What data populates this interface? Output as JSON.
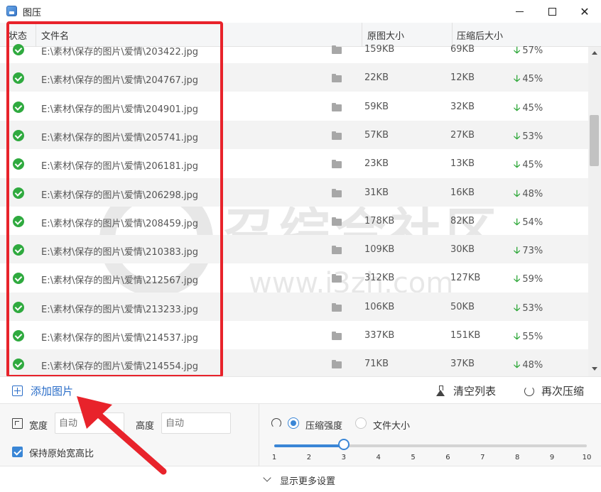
{
  "window": {
    "title": "图压",
    "minimize_icon": "minimize-icon",
    "maximize_icon": "maximize-icon",
    "close_icon": "close-icon"
  },
  "table": {
    "headers": {
      "status": "状态",
      "filename": "文件名",
      "original_size": "原图大小",
      "compressed_size": "压缩后大小"
    },
    "rows": [
      {
        "path": "E:\\素材\\保存的图片\\爱情\\203422.jpg",
        "original": "159KB",
        "compressed": "69KB",
        "ratio": "57%"
      },
      {
        "path": "E:\\素材\\保存的图片\\爱情\\204767.jpg",
        "original": "22KB",
        "compressed": "12KB",
        "ratio": "45%"
      },
      {
        "path": "E:\\素材\\保存的图片\\爱情\\204901.jpg",
        "original": "59KB",
        "compressed": "32KB",
        "ratio": "45%"
      },
      {
        "path": "E:\\素材\\保存的图片\\爱情\\205741.jpg",
        "original": "57KB",
        "compressed": "27KB",
        "ratio": "53%"
      },
      {
        "path": "E:\\素材\\保存的图片\\爱情\\206181.jpg",
        "original": "23KB",
        "compressed": "13KB",
        "ratio": "45%"
      },
      {
        "path": "E:\\素材\\保存的图片\\爱情\\206298.jpg",
        "original": "31KB",
        "compressed": "16KB",
        "ratio": "48%"
      },
      {
        "path": "E:\\素材\\保存的图片\\爱情\\208459.jpg",
        "original": "178KB",
        "compressed": "82KB",
        "ratio": "54%"
      },
      {
        "path": "E:\\素材\\保存的图片\\爱情\\210383.jpg",
        "original": "109KB",
        "compressed": "30KB",
        "ratio": "73%"
      },
      {
        "path": "E:\\素材\\保存的图片\\爱情\\212567.jpg",
        "original": "312KB",
        "compressed": "127KB",
        "ratio": "59%"
      },
      {
        "path": "E:\\素材\\保存的图片\\爱情\\213233.jpg",
        "original": "106KB",
        "compressed": "50KB",
        "ratio": "53%"
      },
      {
        "path": "E:\\素材\\保存的图片\\爱情\\214537.jpg",
        "original": "337KB",
        "compressed": "151KB",
        "ratio": "55%"
      },
      {
        "path": "E:\\素材\\保存的图片\\爱情\\214554.jpg",
        "original": "71KB",
        "compressed": "37KB",
        "ratio": "48%"
      }
    ]
  },
  "watermark": {
    "text": "召综合社区",
    "url": "www.i3zh.com"
  },
  "toolbar": {
    "add_label": "添加图片",
    "clear_label": "清空列表",
    "recompress_label": "再次压缩"
  },
  "settings": {
    "width_label": "宽度",
    "width_placeholder": "自动",
    "height_label": "高度",
    "height_placeholder": "自动",
    "keep_ratio_label": "保持原始宽高比",
    "keep_ratio_checked": true,
    "mode_strength_label": "压缩强度",
    "mode_size_label": "文件大小",
    "selected_mode": "压缩强度",
    "slider_value": 3,
    "slider_min": 1,
    "slider_max": 10,
    "ticks": [
      "1",
      "2",
      "3",
      "4",
      "5",
      "6",
      "7",
      "8",
      "9",
      "10"
    ]
  },
  "more_settings_label": "显示更多设置",
  "colors": {
    "accent": "#3a86d6",
    "success": "#2faa3f",
    "highlight": "#e8232b",
    "link": "#2a6dc8"
  }
}
